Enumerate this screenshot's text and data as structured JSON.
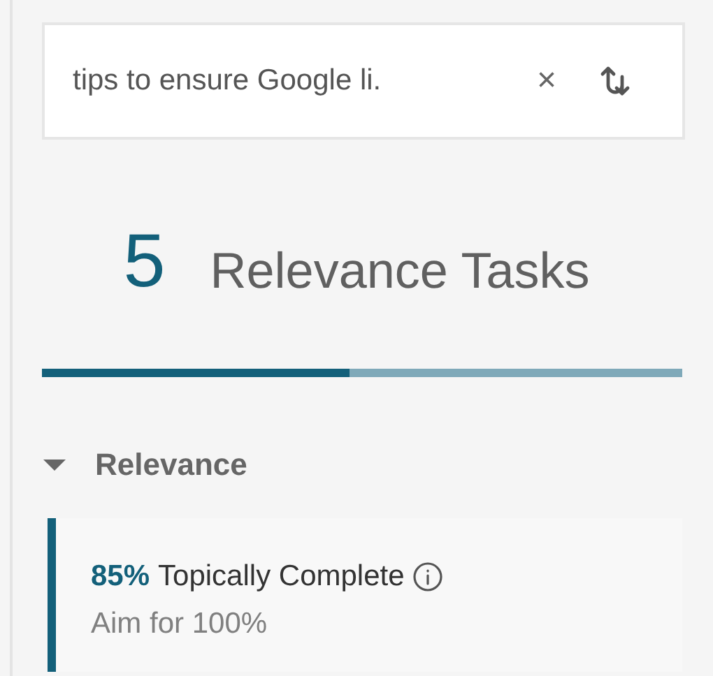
{
  "search": {
    "value": "tips to ensure Google li.",
    "clear": "×"
  },
  "summary": {
    "count": "5",
    "title": "Relevance Tasks",
    "level": 0.48
  },
  "section": {
    "title": "Relevance",
    "expanded": true,
    "items": [
      {
        "score": "85%",
        "label": "Topically Complete",
        "hint": "Aim for 100%"
      }
    ]
  }
}
